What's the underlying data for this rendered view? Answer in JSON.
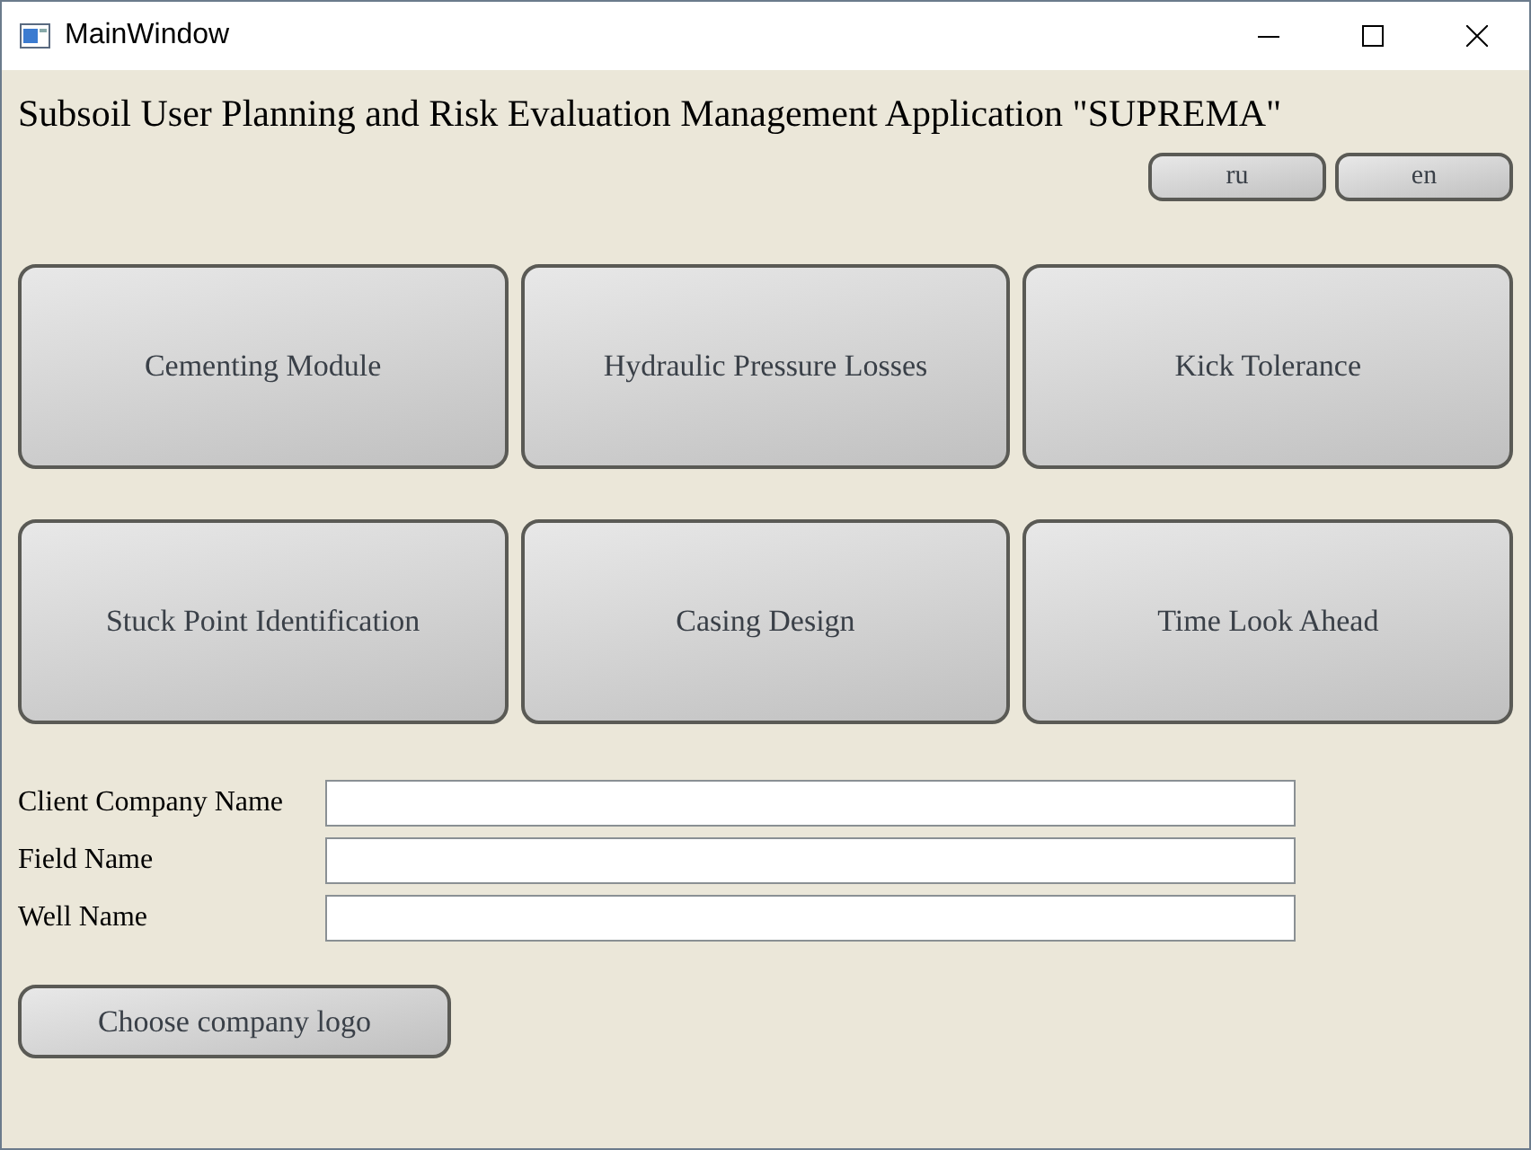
{
  "window": {
    "title": "MainWindow"
  },
  "heading": "Subsoil User Planning and Risk Evaluation Management Application \"SUPREMA\"",
  "languages": [
    "ru",
    "en"
  ],
  "modules": [
    "Cementing Module",
    "Hydraulic Pressure Losses",
    "Kick Tolerance",
    "Stuck Point Identification",
    "Casing Design",
    "Time Look Ahead"
  ],
  "fields": [
    {
      "label": "Client Company Name"
    },
    {
      "label": "Field Name"
    },
    {
      "label": "Well Name"
    }
  ],
  "logo_button": "Choose company logo"
}
